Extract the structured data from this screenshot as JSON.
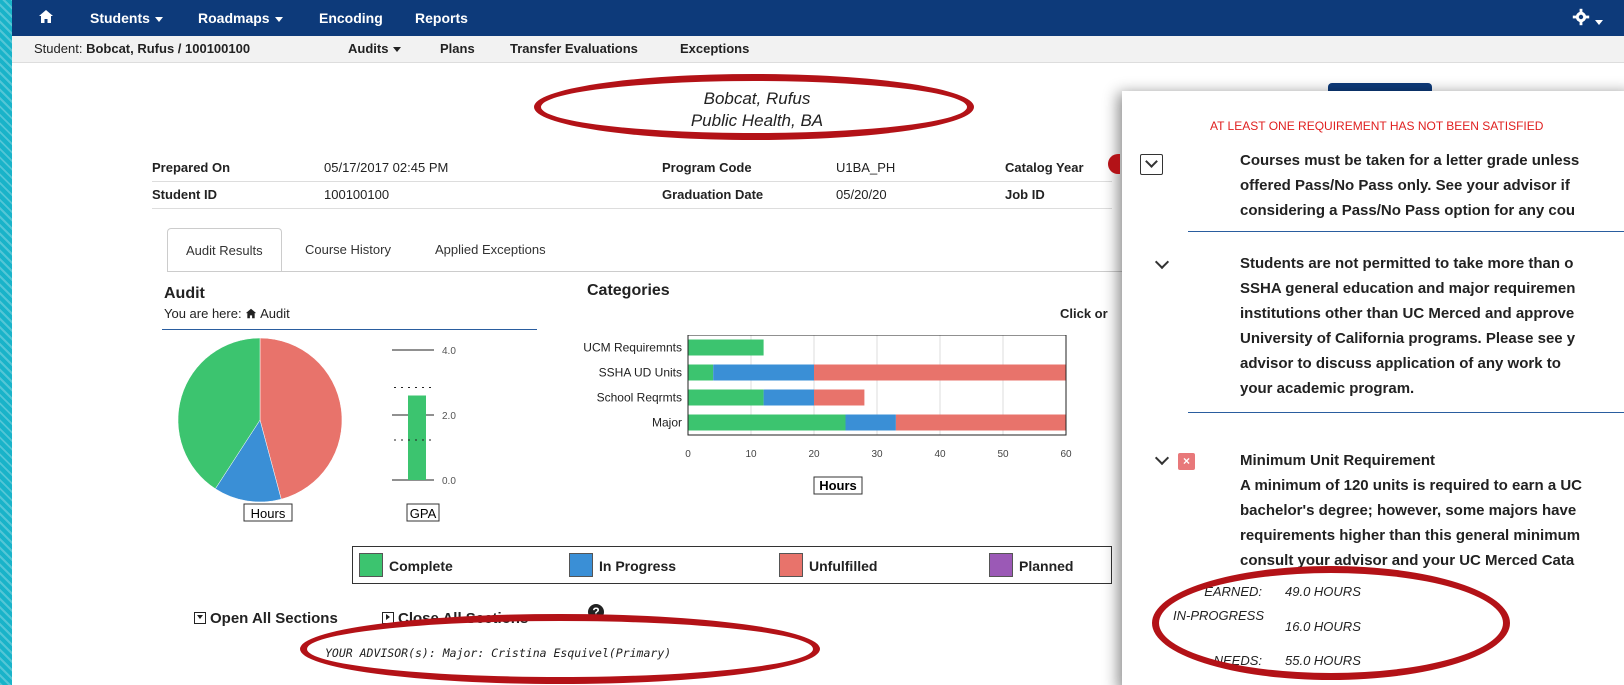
{
  "navbar": {
    "items": [
      {
        "label": "Students",
        "dropdown": true
      },
      {
        "label": "Roadmaps",
        "dropdown": true
      },
      {
        "label": "Encoding",
        "dropdown": false
      },
      {
        "label": "Reports",
        "dropdown": false
      }
    ],
    "home_icon": "home-icon",
    "settings_icon": "gear-icon"
  },
  "subnav": {
    "student_prefix": "Student:",
    "student_name": "Bobcat, Rufus / 100100100",
    "tabs": [
      "Audits",
      "Plans",
      "Transfer Evaluations",
      "Exceptions"
    ]
  },
  "header": {
    "name": "Bobcat, Rufus",
    "program": "Public Health, BA"
  },
  "info": {
    "prepared_on_label": "Prepared On",
    "prepared_on": "05/17/2017 02:45 PM",
    "student_id_label": "Student ID",
    "student_id": "100100100",
    "program_code_label": "Program Code",
    "program_code": "U1BA_PH",
    "graduation_date_label": "Graduation Date",
    "graduation_date": "05/20/20",
    "catalog_year_label": "Catalog Year",
    "job_id_label": "Job ID"
  },
  "content_tabs": [
    "Audit Results",
    "Course History",
    "Applied Exceptions"
  ],
  "audit": {
    "title": "Audit",
    "breadcrumb_prefix": "You are here:",
    "breadcrumb_item": "Audit",
    "hours_label": "Hours",
    "gpa_label": "GPA"
  },
  "categories": {
    "title": "Categories",
    "click_hint": "Click or",
    "axis_label": "Hours"
  },
  "chart_data": [
    {
      "type": "pie",
      "xlabel": "Hours",
      "labels": [
        "Complete",
        "In Progress",
        "Unfulfilled"
      ],
      "values": [
        49,
        16,
        55
      ],
      "colors": [
        "#3cc46f",
        "#3a8fd6",
        "#e8736b"
      ]
    },
    {
      "type": "bar",
      "xlabel": "GPA",
      "categories": [
        "GPA"
      ],
      "values": [
        2.6
      ],
      "ylim": [
        0,
        4
      ],
      "yticks": [
        "4.0",
        "2.0",
        "0.0"
      ]
    },
    {
      "type": "bar",
      "orientation": "horizontal",
      "stacked": true,
      "xlabel": "Hours",
      "categories": [
        "UCM Requiremnts",
        "SSHA UD Units",
        "School Reqrmts",
        "Major"
      ],
      "series": [
        {
          "name": "Complete",
          "color": "#3cc46f",
          "values": [
            12,
            4,
            12,
            25
          ]
        },
        {
          "name": "In Progress",
          "color": "#3a8fd6",
          "values": [
            0,
            16,
            8,
            8
          ]
        },
        {
          "name": "Unfulfilled",
          "color": "#e8736b",
          "values": [
            0,
            40,
            8,
            28
          ]
        }
      ],
      "xlim": [
        0,
        60
      ],
      "xticks": [
        0,
        10,
        20,
        30,
        40,
        50,
        60
      ]
    }
  ],
  "legend": [
    {
      "label": "Complete",
      "color": "#3cc46f"
    },
    {
      "label": "In Progress",
      "color": "#3a8fd6"
    },
    {
      "label": "Unfulfilled",
      "color": "#e8736b"
    },
    {
      "label": "Planned",
      "color": "#9b59b6"
    }
  ],
  "sections": {
    "open_all": "Open All Sections",
    "close_all": "Close All Sections",
    "help_icon": "question-circle-icon"
  },
  "advisor_text": "YOUR ADVISOR(s): Major: Cristina Esquivel(Primary)",
  "panel": {
    "warning": "AT LEAST ONE REQUIREMENT HAS NOT BEEN SATISFIED",
    "req1": [
      "Courses must be taken for a letter grade unless",
      "offered Pass/No Pass only. See your advisor if",
      "considering a Pass/No Pass option for any cou"
    ],
    "req2": [
      "Students are not permitted to take more than o",
      "SSHA general education and major requiremen",
      "institutions other than UC Merced and approve",
      "University of California programs. Please see y",
      "advisor to discuss application of any work to",
      "your academic program."
    ],
    "req3_title": "Minimum Unit Requirement",
    "req3": [
      "A minimum of 120 units is required to earn a UC",
      "bachelor's degree; however, some majors have",
      "requirements higher than this general minimum",
      "consult your advisor and your UC Merced Cata"
    ],
    "units": [
      {
        "label": "EARNED:",
        "value": "49.0 HOURS"
      },
      {
        "label": "IN-PROGRESS",
        "value": "16.0 HOURS"
      },
      {
        "label": "NEEDS:",
        "value": "55.0 HOURS"
      }
    ]
  }
}
